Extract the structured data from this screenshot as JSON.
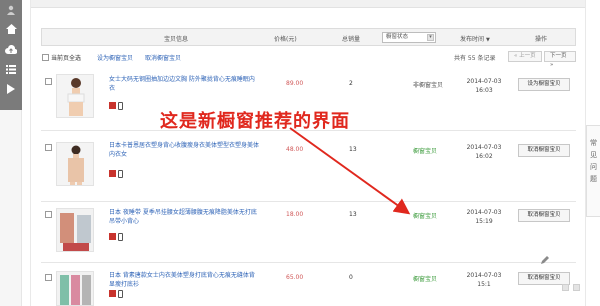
{
  "sidebar": {
    "icons": [
      "user-icon",
      "home-icon",
      "cloud-icon",
      "list-icon",
      "play-icon"
    ]
  },
  "right_tab": {
    "chars": [
      "常",
      "见",
      "问",
      "题"
    ]
  },
  "table_header": {
    "product_info": "宝贝信息",
    "price": "价格(元)",
    "sold": "总销量",
    "status_select": "橱窗状态",
    "publish_time": "发布时间",
    "sort_arrow": "▼",
    "action": "操作"
  },
  "toolbar": {
    "select_all": "当前页全选",
    "set_window": "设为橱窗宝贝",
    "cancel_window": "取消橱窗宝贝",
    "count": "共有 55 条记录",
    "prev": "« 上一页",
    "next": "下一页 »"
  },
  "annotation": "这是新橱窗推荐的界面",
  "colors": {
    "link": "#2f64b7",
    "price": "#d05757",
    "status_green": "#3b9b3b",
    "annotation_red": "#e0281e",
    "sidebar": "#7b7b7b"
  },
  "rows": [
    {
      "title": "女士大码无钢圈抽加边边文胸 防外聚拢背心无痕睡眠内衣",
      "price": "89.00",
      "qty": "2",
      "status": "非橱窗宝贝",
      "status_type": "gray",
      "date": "2014-07-03",
      "time": "16:03",
      "action": "设为橱窗宝贝"
    },
    {
      "title": "日本卡普恩居衣塑身背心收腹瘦身衣美体塑型衣塑身美体内衣女",
      "price": "48.00",
      "qty": "13",
      "status": "橱窗宝贝",
      "status_type": "green",
      "date": "2014-07-03",
      "time": "16:02",
      "action": "取消橱窗宝贝"
    },
    {
      "title": "日本 夜睡带 夏季吊挂腰女超薄腰腹无痕降脂美体无打底吊带小背心",
      "price": "18.00",
      "qty": "13",
      "status": "橱窗宝贝",
      "status_type": "green",
      "date": "2014-07-03",
      "time": "15:19",
      "action": "取消橱窗宝贝"
    },
    {
      "title": "日本 背素唐款女士内衣美体塑身打底背心无痕无缝体背显瘦打底衫",
      "price": "65.00",
      "qty": "0",
      "status": "橱窗宝贝",
      "status_type": "green",
      "date": "2014-07-03",
      "time": "15:1",
      "action": "取消橱窗宝贝"
    }
  ]
}
